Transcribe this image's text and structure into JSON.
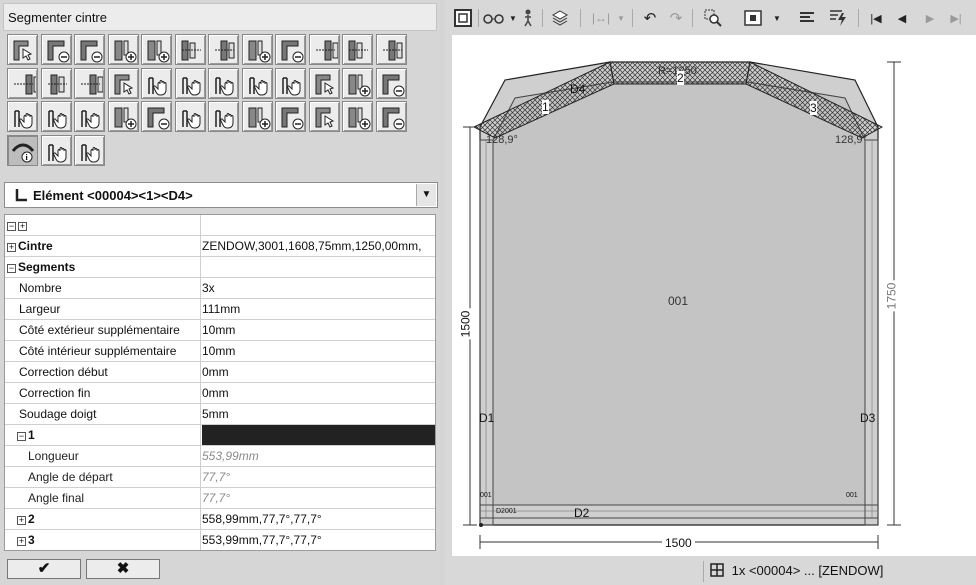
{
  "panel": {
    "title": "Segmenter cintre",
    "tool_icons": [
      "corner-select-icon",
      "corner-remove-icon",
      "profile-remove-icon",
      "split-add-icon",
      "split-add-2-icon",
      "frame-edit-icon",
      "bar-edit-icon",
      "connect-add-icon",
      "part-remove-icon",
      "profile-point-icon",
      "profile-point-2-icon",
      "double-bar-icon",
      "bar-edit-2-icon",
      "profile-point-3-icon",
      "mullion-edit-icon",
      "frame-select-icon",
      "move-hand-icon",
      "move-hand-2-icon",
      "move-hand-3-icon",
      "move-hand-4-icon",
      "move-hand-5-icon",
      "frame-select-2-icon",
      "frame-add-icon",
      "frame-remove-icon",
      "grid-hand-icon",
      "grid-hand-2-icon",
      "grid-hand-3-icon",
      "join-add-icon",
      "join-remove-icon",
      "grid-hand-4-icon",
      "grid-hand-5-icon",
      "join-add-2-icon",
      "join-remove-2-icon",
      "bar-select-icon",
      "bar-add-icon",
      "bar-remove-icon",
      "segment-info-icon",
      "axis-hand-icon",
      "grid-hand-6-icon"
    ]
  },
  "element": {
    "label": "Elément <00004><1><D4>",
    "dropdown_icon": "chevron-down-icon"
  },
  "properties": {
    "rows": [
      {
        "key": "",
        "value": "",
        "type": "header"
      },
      {
        "key": "Cintre",
        "value": "ZENDOW,3001,1608,75mm,1250,00mm,",
        "type": "bold",
        "expander": "+"
      },
      {
        "key": "Segments",
        "value": "",
        "type": "bold",
        "expander": "-"
      },
      {
        "key": "Nombre",
        "value": "3x",
        "type": "normal"
      },
      {
        "key": "Largeur",
        "value": "111mm",
        "type": "normal"
      },
      {
        "key": "Côté extérieur supplémentaire",
        "value": "10mm",
        "type": "normal"
      },
      {
        "key": "Côté intérieur supplémentaire",
        "value": "10mm",
        "type": "normal"
      },
      {
        "key": "Correction début",
        "value": "0mm",
        "type": "normal"
      },
      {
        "key": "Correction fin",
        "value": "0mm",
        "type": "normal"
      },
      {
        "key": "Soudage doigt",
        "value": "5mm",
        "type": "normal"
      },
      {
        "key": "1",
        "value": "",
        "type": "group-dark",
        "expander": "-"
      },
      {
        "key": "Longueur",
        "value": "553,99mm",
        "type": "sub"
      },
      {
        "key": "Angle de départ",
        "value": "77,7°",
        "type": "sub"
      },
      {
        "key": "Angle final",
        "value": "77,7°",
        "type": "sub"
      },
      {
        "key": "2",
        "value": "558,99mm,77,7°,77,7°",
        "type": "group",
        "expander": "+"
      },
      {
        "key": "3",
        "value": "553,99mm,77,7°,77,7°",
        "type": "group",
        "expander": "+"
      }
    ]
  },
  "buttons": {
    "ok": "✔",
    "cancel": "✖"
  },
  "toolbar_icons": [
    "view-mode-icon",
    "glasses-icon",
    "person-icon",
    "layers-icon",
    "measure-icon",
    "undo-icon",
    "redo-icon",
    "zoom-icon",
    "select-frame-icon",
    "align-icon",
    "lightning-icon",
    "first-icon",
    "prev-icon",
    "next-icon",
    "last-icon"
  ],
  "drawing": {
    "center_label": "001",
    "width_dim": "1500",
    "left_height_dim": "1500",
    "right_height_dim": "1750",
    "angle_left": "128,9°",
    "angle_right": "128,9°",
    "arc_label": "R=1250",
    "segments": [
      "1",
      "2",
      "3"
    ],
    "profile_labels": [
      "D1",
      "D2",
      "D3",
      "D4"
    ],
    "small_labels": [
      "D2001",
      "001",
      "001"
    ]
  },
  "status": {
    "icon": "grid-icon",
    "text": "1x <00004> ... [ZENDOW]"
  }
}
